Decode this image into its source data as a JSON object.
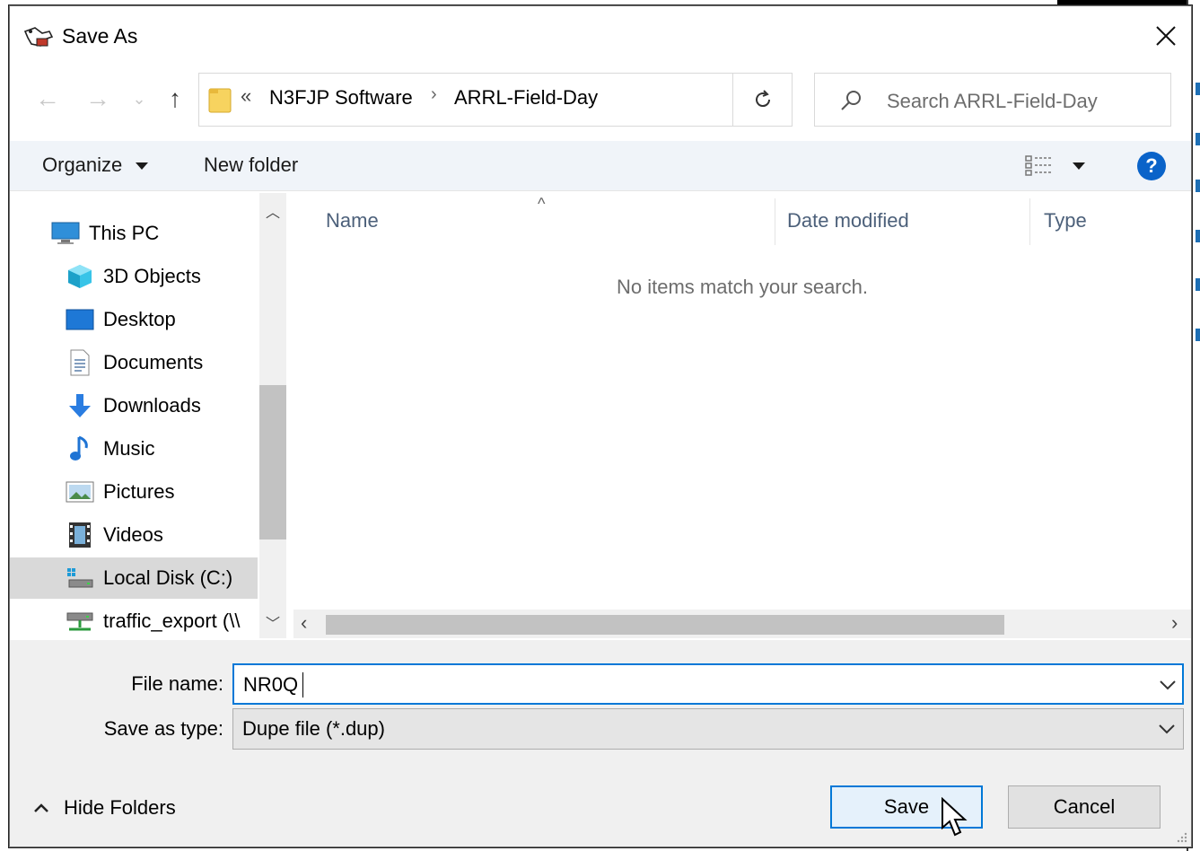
{
  "window": {
    "title": "Save As",
    "close_label": "✕"
  },
  "nav": {
    "back": "←",
    "forward": "→",
    "recent": "⌄",
    "up": "↑"
  },
  "address": {
    "overflow": "«",
    "crumbs": [
      "N3FJP Software",
      "ARRL-Field-Day"
    ],
    "separator": "›"
  },
  "search": {
    "placeholder": "Search ARRL-Field-Day"
  },
  "toolbar": {
    "organize": "Organize",
    "new_folder": "New folder",
    "help": "?"
  },
  "navpane": {
    "items": [
      {
        "label": "This PC",
        "icon": "monitor-icon"
      },
      {
        "label": "3D Objects",
        "icon": "cube-icon"
      },
      {
        "label": "Desktop",
        "icon": "desktop-icon"
      },
      {
        "label": "Documents",
        "icon": "document-icon"
      },
      {
        "label": "Downloads",
        "icon": "download-arrow-icon"
      },
      {
        "label": "Music",
        "icon": "music-note-icon"
      },
      {
        "label": "Pictures",
        "icon": "picture-icon"
      },
      {
        "label": "Videos",
        "icon": "film-icon"
      },
      {
        "label": "Local Disk (C:)",
        "icon": "drive-icon",
        "selected": true
      },
      {
        "label": "traffic_export (\\\\",
        "icon": "network-drive-icon"
      }
    ]
  },
  "filelist": {
    "columns": [
      "Name",
      "Date modified",
      "Type"
    ],
    "empty_message": "No items match your search."
  },
  "form": {
    "file_name_label": "File name:",
    "file_name_value": "NR0Q",
    "save_type_label": "Save as type:",
    "save_type_value": "Dupe file (*.dup)"
  },
  "footer": {
    "hide_folders": "Hide Folders",
    "save": "Save",
    "cancel": "Cancel"
  },
  "colors": {
    "accent": "#0078d7",
    "help": "#0a63c9",
    "column_header": "#4c607a",
    "selected": "#d9d9d9"
  }
}
